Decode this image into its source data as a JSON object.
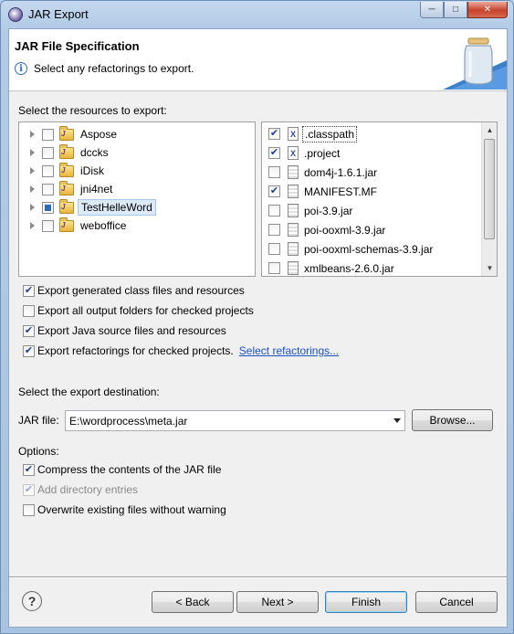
{
  "window": {
    "title": "JAR Export"
  },
  "header": {
    "title": "JAR File Specification",
    "message": "Select any refactorings to export."
  },
  "resources": {
    "label": "Select the resources to export:",
    "projects": [
      {
        "label": "Aspose",
        "state": "unchecked",
        "selected": false
      },
      {
        "label": "dccks",
        "state": "unchecked",
        "selected": false
      },
      {
        "label": "iDisk",
        "state": "unchecked",
        "selected": false
      },
      {
        "label": "jni4net",
        "state": "unchecked",
        "selected": false
      },
      {
        "label": "TestHelleWord",
        "state": "partial",
        "selected": true
      },
      {
        "label": "weboffice",
        "state": "unchecked",
        "selected": false
      }
    ],
    "files": [
      {
        "label": ".classpath",
        "checked": true,
        "icon": "xml-file-icon"
      },
      {
        "label": ".project",
        "checked": true,
        "icon": "xml-file-icon"
      },
      {
        "label": "dom4j-1.6.1.jar",
        "checked": false,
        "icon": "jar-file-icon"
      },
      {
        "label": "MANIFEST.MF",
        "checked": true,
        "icon": "jar-file-icon"
      },
      {
        "label": "poi-3.9.jar",
        "checked": false,
        "icon": "jar-file-icon"
      },
      {
        "label": "poi-ooxml-3.9.jar",
        "checked": false,
        "icon": "jar-file-icon"
      },
      {
        "label": "poi-ooxml-schemas-3.9.jar",
        "checked": false,
        "icon": "jar-file-icon"
      },
      {
        "label": "xmlbeans-2.6.0.jar",
        "checked": false,
        "icon": "jar-file-icon"
      }
    ]
  },
  "export_options": [
    {
      "label": "Export generated class files and resources",
      "checked": true
    },
    {
      "label": "Export all output folders for checked projects",
      "checked": false
    },
    {
      "label": "Export Java source files and resources",
      "checked": true
    },
    {
      "label": "Export refactorings for checked projects.",
      "checked": true
    }
  ],
  "select_refactorings_link": "Select refactorings...",
  "destination": {
    "label": "Select the export destination:",
    "jar_file_label": "JAR file:",
    "jar_file_value": "E:\\wordprocess\\meta.jar",
    "browse_label": "Browse..."
  },
  "options": {
    "label": "Options:",
    "items": [
      {
        "label": "Compress the contents of the JAR file",
        "checked": true,
        "disabled": false
      },
      {
        "label": "Add directory entries",
        "checked": true,
        "disabled": true
      },
      {
        "label": "Overwrite existing files without warning",
        "checked": false,
        "disabled": false
      }
    ]
  },
  "buttons": {
    "back": "< Back",
    "next": "Next >",
    "finish": "Finish",
    "cancel": "Cancel"
  }
}
